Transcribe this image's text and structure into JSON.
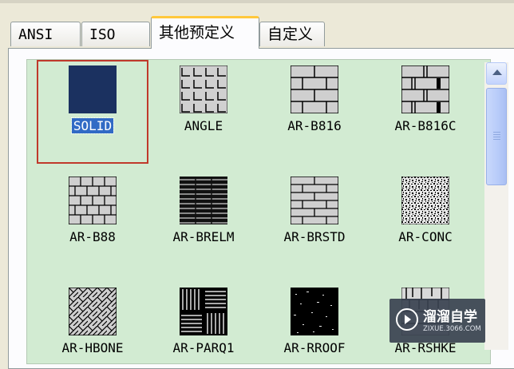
{
  "tabs": [
    {
      "label": "ANSI",
      "selected": false
    },
    {
      "label": "ISO",
      "selected": false
    },
    {
      "label": "其他预定义",
      "selected": true
    },
    {
      "label": "自定义",
      "selected": false
    }
  ],
  "patterns": [
    {
      "label": "SOLID",
      "icon": "solid-fill-icon",
      "selected": true
    },
    {
      "label": "ANGLE",
      "icon": "angle-pattern-icon",
      "selected": false
    },
    {
      "label": "AR-B816",
      "icon": "ar-b816-pattern-icon",
      "selected": false
    },
    {
      "label": "AR-B816C",
      "icon": "ar-b816c-pattern-icon",
      "selected": false
    },
    {
      "label": "AR-B88",
      "icon": "ar-b88-pattern-icon",
      "selected": false
    },
    {
      "label": "AR-BRELM",
      "icon": "ar-brelm-pattern-icon",
      "selected": false
    },
    {
      "label": "AR-BRSTD",
      "icon": "ar-brstd-pattern-icon",
      "selected": false
    },
    {
      "label": "AR-CONC",
      "icon": "ar-conc-pattern-icon",
      "selected": false
    },
    {
      "label": "AR-HBONE",
      "icon": "ar-hbone-pattern-icon",
      "selected": false
    },
    {
      "label": "AR-PARQ1",
      "icon": "ar-parq1-pattern-icon",
      "selected": false
    },
    {
      "label": "AR-RROOF",
      "icon": "ar-rroof-pattern-icon",
      "selected": false
    },
    {
      "label": "AR-RSHKE",
      "icon": "ar-rshke-pattern-icon",
      "selected": false
    }
  ],
  "watermark": {
    "title": "溜溜自学",
    "url": "ZIXUE.3066.COM"
  },
  "colors": {
    "selection_border": "#c0392b",
    "solid_fill": "#1b3160",
    "list_background": "#d2ebd2",
    "tab_highlight": "#ffc83c"
  }
}
